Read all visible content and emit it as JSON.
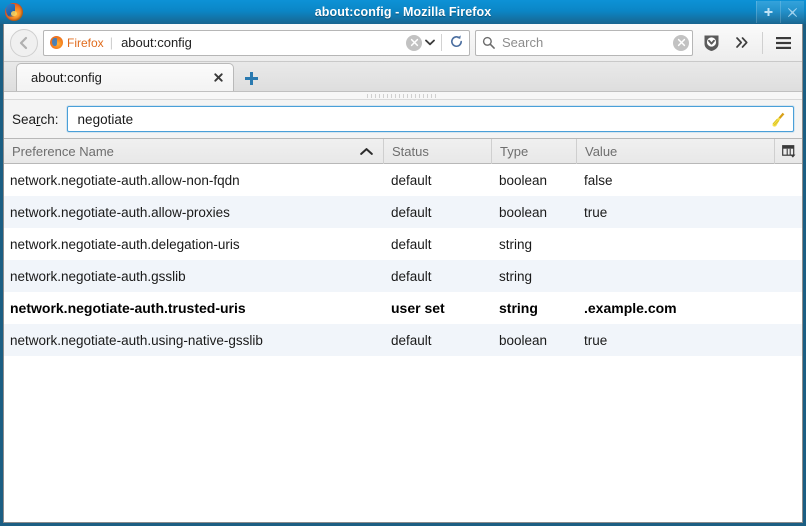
{
  "window": {
    "title": "about:config - Mozilla Firefox",
    "logo_icon": "firefox-logo-icon",
    "controls": [
      {
        "name": "maximize-button",
        "glyph": "+"
      },
      {
        "name": "close-button",
        "glyph": "✕"
      }
    ]
  },
  "navbar": {
    "back_icon": "back-arrow-icon",
    "identity_icon": "firefox-identity-icon",
    "identity_label": "Firefox",
    "identity_separator": "|",
    "url_value": "about:config",
    "url_clear_icon": "clear-circle-icon",
    "url_dropdown_icon": "chevron-down-icon",
    "reload_icon": "reload-icon",
    "search_icon": "search-magnifier-icon",
    "search_placeholder": "Search",
    "search_clear_icon": "clear-circle-icon",
    "pocket_icon": "shield-icon",
    "overflow_icon": "double-chevron-right-icon",
    "menu_icon": "hamburger-menu-icon"
  },
  "tabstrip": {
    "tab_label": "about:config",
    "tab_close_icon": "close-x-icon",
    "newtab_icon": "plus-new-tab-icon",
    "newtab_glyph": "✚"
  },
  "config": {
    "search_label_pre": "Sea",
    "search_label_key": "r",
    "search_label_post": "ch:",
    "filter_value": "negotiate",
    "clear_icon": "broom-clear-icon",
    "columns": [
      {
        "key": "name",
        "label": "Preference Name",
        "sort": "ascending",
        "sort_icon": "caret-up-icon"
      },
      {
        "key": "status",
        "label": "Status"
      },
      {
        "key": "type",
        "label": "Type"
      },
      {
        "key": "value",
        "label": "Value"
      }
    ],
    "column_picker_icon": "column-picker-icon",
    "rows": [
      {
        "name": "network.negotiate-auth.allow-non-fqdn",
        "status": "default",
        "type": "boolean",
        "value": "false",
        "userset": false
      },
      {
        "name": "network.negotiate-auth.allow-proxies",
        "status": "default",
        "type": "boolean",
        "value": "true",
        "userset": false
      },
      {
        "name": "network.negotiate-auth.delegation-uris",
        "status": "default",
        "type": "string",
        "value": "",
        "userset": false
      },
      {
        "name": "network.negotiate-auth.gsslib",
        "status": "default",
        "type": "string",
        "value": "",
        "userset": false
      },
      {
        "name": "network.negotiate-auth.trusted-uris",
        "status": "user set",
        "type": "string",
        "value": ".example.com",
        "userset": true
      },
      {
        "name": "network.negotiate-auth.using-native-gsslib",
        "status": "default",
        "type": "boolean",
        "value": "true",
        "userset": false
      }
    ]
  },
  "colors": {
    "titlebar_top": "#0d92d6",
    "titlebar_bottom": "#186590",
    "frame": "#1b5e83",
    "focus_border": "#4a9fd8",
    "row_alt": "#f1f5fa",
    "identity_orange": "#e06c1e"
  }
}
